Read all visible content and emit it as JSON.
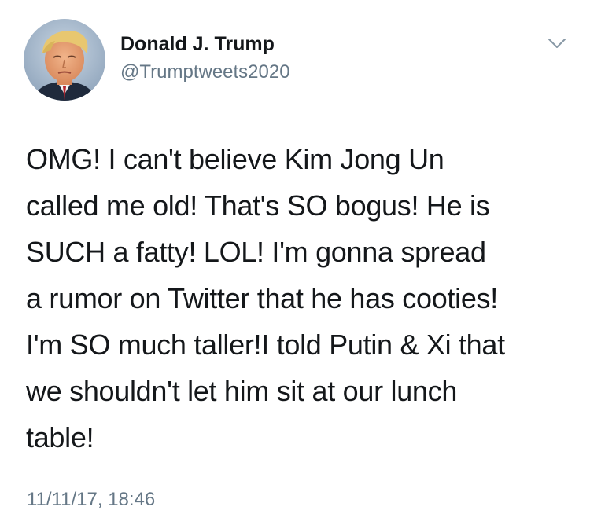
{
  "author": {
    "display_name": "Donald J. Trump",
    "handle": "@Trumptweets2020",
    "avatar_icon": "profile-photo-portrait"
  },
  "menu": {
    "icon": "chevron-down-icon"
  },
  "tweet": {
    "lines": [
      "OMG! I can't believe Kim Jong Un",
      "called me old! That's SO bogus! He is",
      "SUCH a fatty! LOL! I'm gonna spread",
      "a rumor on Twitter that he has cooties!",
      "I'm SO much taller!I told Putin & Xi that",
      "we shouldn't let him sit at our lunch",
      "table!"
    ],
    "timestamp": "11/11/17, 18:46"
  },
  "colors": {
    "text_primary": "#14171a",
    "text_secondary": "#657786",
    "background": "#ffffff"
  }
}
